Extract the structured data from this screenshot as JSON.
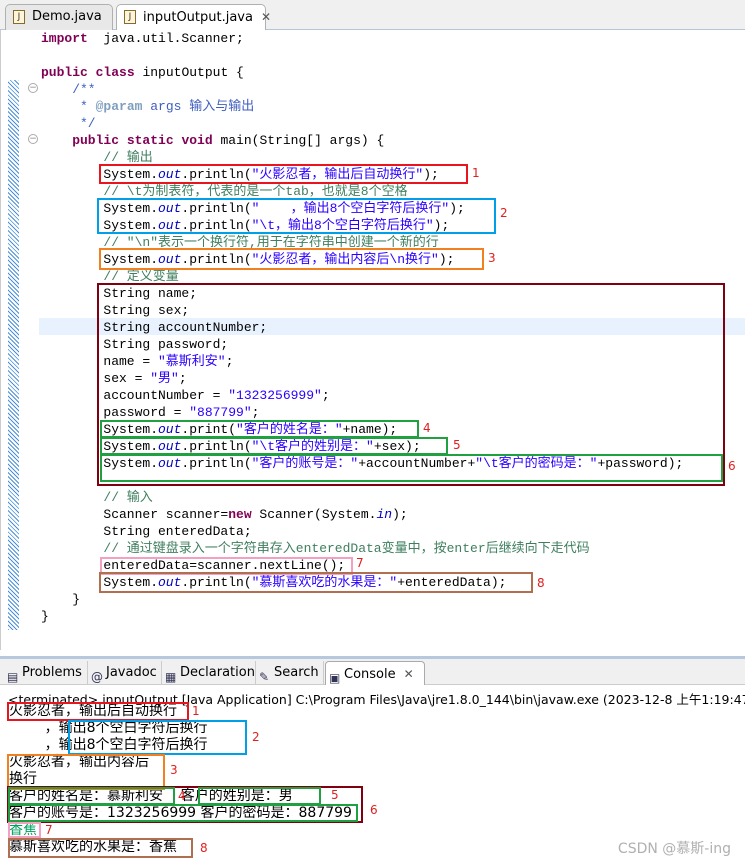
{
  "editor_tabs": [
    {
      "label": "Demo.java",
      "active": false
    },
    {
      "label": "inputOutput.java",
      "active": true
    }
  ],
  "close_icon": "✕",
  "code_colors": {
    "keyword": "#7f0055",
    "string": "#2a00ff",
    "comment": "#3f7f5f",
    "javadoc": "#3f5fbf",
    "field": "#0000c0"
  },
  "code_lines": [
    {
      "indent": 0,
      "segs": [
        [
          "kw",
          "import"
        ],
        [
          "",
          "  java.util.Scanner;"
        ]
      ]
    },
    {
      "indent": 0,
      "segs": []
    },
    {
      "indent": 0,
      "segs": [
        [
          "kw",
          "public"
        ],
        [
          "",
          " "
        ],
        [
          "kw",
          "class"
        ],
        [
          "",
          " inputOutput {"
        ]
      ]
    },
    {
      "indent": 4,
      "segs": [
        [
          "jd",
          "/**"
        ]
      ]
    },
    {
      "indent": 5,
      "segs": [
        [
          "jd",
          "* "
        ],
        [
          "tg",
          "@param"
        ],
        [
          "jd",
          " args 输入与输出"
        ]
      ]
    },
    {
      "indent": 5,
      "segs": [
        [
          "jd",
          "*/"
        ]
      ]
    },
    {
      "indent": 4,
      "segs": [
        [
          "kw",
          "public"
        ],
        [
          "",
          " "
        ],
        [
          "kw",
          "static"
        ],
        [
          "",
          " "
        ],
        [
          "kw",
          "void"
        ],
        [
          "",
          " main(String[] args) {"
        ]
      ]
    },
    {
      "indent": 8,
      "segs": [
        [
          "cm",
          "// 输出"
        ]
      ]
    },
    {
      "indent": 8,
      "segs": [
        [
          "",
          "System."
        ],
        [
          "fd",
          "out"
        ],
        [
          "",
          ".println("
        ],
        [
          "st",
          "\"火影忍者，输出后自动换行\""
        ],
        [
          "",
          ");"
        ]
      ]
    },
    {
      "indent": 8,
      "segs": [
        [
          "cm",
          "// \\t为制表符，代表的是一个tab，也就是8个空格"
        ]
      ]
    },
    {
      "indent": 8,
      "segs": [
        [
          "",
          "System."
        ],
        [
          "fd",
          "out"
        ],
        [
          "",
          ".println("
        ],
        [
          "st",
          "\"    ，输出8个空白字符后换行\""
        ],
        [
          "",
          ");"
        ]
      ]
    },
    {
      "indent": 8,
      "segs": [
        [
          "",
          "System."
        ],
        [
          "fd",
          "out"
        ],
        [
          "",
          ".println("
        ],
        [
          "st",
          "\"\\t，输出8个空白字符后换行\""
        ],
        [
          "",
          ");"
        ]
      ]
    },
    {
      "indent": 8,
      "segs": [
        [
          "cm",
          "// \"\\n\"表示一个换行符,用于在字符串中创建一个新的行"
        ]
      ]
    },
    {
      "indent": 8,
      "segs": [
        [
          "",
          "System."
        ],
        [
          "fd",
          "out"
        ],
        [
          "",
          ".println("
        ],
        [
          "st",
          "\"火影忍者，输出内容后\\n换行\""
        ],
        [
          "",
          ");"
        ]
      ]
    },
    {
      "indent": 8,
      "segs": [
        [
          "cm",
          "// 定义变量"
        ]
      ]
    },
    {
      "indent": 8,
      "segs": [
        [
          "",
          "String name;"
        ]
      ]
    },
    {
      "indent": 8,
      "segs": [
        [
          "",
          "String sex;"
        ]
      ]
    },
    {
      "indent": 8,
      "segs": [
        [
          "",
          "String accountNumber;"
        ]
      ]
    },
    {
      "indent": 8,
      "segs": [
        [
          "",
          "String password;"
        ]
      ]
    },
    {
      "indent": 8,
      "segs": [
        [
          "",
          "name = "
        ],
        [
          "st",
          "\"慕斯利安\""
        ],
        [
          "",
          ";"
        ]
      ]
    },
    {
      "indent": 8,
      "segs": [
        [
          "",
          "sex = "
        ],
        [
          "st",
          "\"男\""
        ],
        [
          "",
          ";"
        ]
      ]
    },
    {
      "indent": 8,
      "segs": [
        [
          "",
          "accountNumber = "
        ],
        [
          "st",
          "\"1323256999\""
        ],
        [
          "",
          ";"
        ]
      ]
    },
    {
      "indent": 8,
      "segs": [
        [
          "",
          "password = "
        ],
        [
          "st",
          "\"887799\""
        ],
        [
          "",
          ";"
        ]
      ]
    },
    {
      "indent": 8,
      "segs": [
        [
          "",
          "System."
        ],
        [
          "fd",
          "out"
        ],
        [
          "",
          ".print("
        ],
        [
          "st",
          "\"客户的姓名是：\""
        ],
        [
          "",
          "+name);"
        ]
      ]
    },
    {
      "indent": 8,
      "segs": [
        [
          "",
          "System."
        ],
        [
          "fd",
          "out"
        ],
        [
          "",
          ".println("
        ],
        [
          "st",
          "\"\\t客户的姓别是：\""
        ],
        [
          "",
          "+sex);"
        ]
      ]
    },
    {
      "indent": 8,
      "segs": [
        [
          "",
          "System."
        ],
        [
          "fd",
          "out"
        ],
        [
          "",
          ".println("
        ],
        [
          "st",
          "\"客户的账号是：\""
        ],
        [
          "",
          "+accountNumber+"
        ],
        [
          "st",
          "\"\\t客户的密码是：\""
        ],
        [
          "",
          "+password);"
        ]
      ]
    },
    {
      "indent": 8,
      "segs": []
    },
    {
      "indent": 8,
      "segs": [
        [
          "cm",
          "// 输入"
        ]
      ]
    },
    {
      "indent": 8,
      "segs": [
        [
          "",
          "Scanner scanner="
        ],
        [
          "kw",
          "new"
        ],
        [
          "",
          " Scanner(System."
        ],
        [
          "fd",
          "in"
        ],
        [
          "",
          ");"
        ]
      ]
    },
    {
      "indent": 8,
      "segs": [
        [
          "",
          "String enteredData;"
        ]
      ]
    },
    {
      "indent": 8,
      "segs": [
        [
          "cm",
          "// 通过键盘录入一个字符串存入enteredData变量中，按enter后继续向下走代码"
        ]
      ]
    },
    {
      "indent": 8,
      "segs": [
        [
          "",
          "enteredData=scanner.nextLine();"
        ]
      ]
    },
    {
      "indent": 8,
      "segs": [
        [
          "",
          "System."
        ],
        [
          "fd",
          "out"
        ],
        [
          "",
          ".println("
        ],
        [
          "st",
          "\"慕斯喜欢吃的水果是：\""
        ],
        [
          "",
          "+enteredData);"
        ]
      ]
    },
    {
      "indent": 4,
      "segs": [
        [
          "",
          "}"
        ]
      ]
    },
    {
      "indent": 0,
      "segs": [
        [
          "",
          "}"
        ]
      ]
    }
  ],
  "annotation_labels": {
    "1": "1",
    "2": "2",
    "3": "3",
    "4": "4",
    "5": "5",
    "6": "6",
    "7": "7",
    "8": "8"
  },
  "annotation_colors": {
    "red": "#e8141e",
    "blue": "#00a0e8",
    "orange": "#f08020",
    "maroon": "#800010",
    "green": "#20a040",
    "pink": "#f4a0c0",
    "brown": "#b07050"
  },
  "bottom_tabs": [
    {
      "label": "Problems",
      "icon": "problems-icon"
    },
    {
      "label": "Javadoc",
      "icon": "at-icon"
    },
    {
      "label": "Declaration",
      "icon": "declaration-icon"
    },
    {
      "label": "Search",
      "icon": "search-icon"
    },
    {
      "label": "Console",
      "icon": "console-icon",
      "active": true
    }
  ],
  "console": {
    "status": "<terminated> inputOutput [Java Application] C:\\Program Files\\Java\\jre1.8.0_144\\bin\\javaw.exe (2023-12-8 上午1:19:47)",
    "lines": [
      "火影忍者，输出后自动换行",
      "        ，输出8个空白字符后换行",
      "        ，输出8个空白字符后换行",
      "火影忍者，输出内容后",
      "换行",
      "客户的姓名是：慕斯利安    客户的姓别是：男",
      "客户的账号是：1323256999 客户的密码是：887799",
      "香蕉",
      "慕斯喜欢吃的水果是：香蕉"
    ],
    "input_color": "#00a060"
  },
  "watermark": "CSDN @慕斯-ing"
}
